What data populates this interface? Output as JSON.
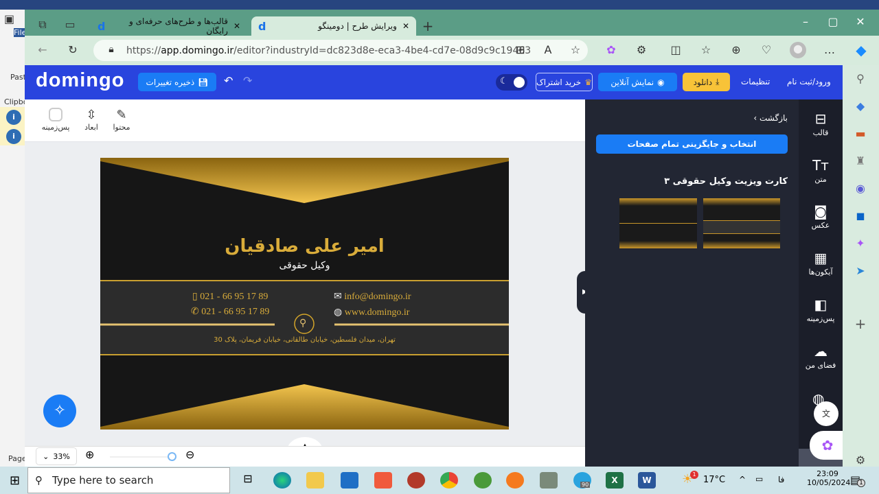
{
  "word": {
    "file": "File",
    "paste": "Paste",
    "clipboard": "Clipbo",
    "page": "Page"
  },
  "browser": {
    "tabs": [
      {
        "title": "قالب‌ها و طرح‌های حرفه‌ای و رایگان",
        "active": false
      },
      {
        "title": "ویرایش طرح | دومینگو",
        "active": true
      }
    ],
    "url_prefix": "https://",
    "url_host": "app.domingo.ir",
    "url_path": "/editor?industryId=dc823d8e-eca3-4be4-cd7e-08d9c9c19463"
  },
  "header": {
    "logo": "domingo",
    "save": "ذخیره تغییرات",
    "subscribe": "خرید اشتراک",
    "preview": "نمایش آنلاین",
    "download": "دانلود",
    "settings": "تنظیمات",
    "login": "ورود/ثبت نام",
    "accent": "#2944de"
  },
  "toolbar": {
    "items": [
      {
        "label": "محتوا",
        "icon": "edit-icon"
      },
      {
        "label": "ابعاد",
        "icon": "resize-icon"
      },
      {
        "label": "پس‌زمینه",
        "icon": "background-swatch-icon"
      }
    ]
  },
  "card": {
    "name": "امیر علی صادقیان",
    "title": "وکیل حقوقی",
    "phone1": "021 - 66 95 17 89",
    "phone2": "021 - 66 95 17 89",
    "email": "info@domingo.ir",
    "web": "www.domingo.ir",
    "address": "تهران، میدان فلسطین، خیابان طالقانی، خیابان فریمان، پلاک 30",
    "gold": "#d4a52a"
  },
  "zoom": {
    "level": "33%",
    "slider_percent": 100
  },
  "panel": {
    "back": "بازگشت",
    "replace_all": "انتخاب و جایگزینی تمام صفحات",
    "template_title": "کارت ویزیت وکیل حقوقی ۳"
  },
  "rail": [
    {
      "label": "قالب",
      "icon": "template-icon"
    },
    {
      "label": "متن",
      "icon": "text-icon"
    },
    {
      "label": "عکس",
      "icon": "image-icon"
    },
    {
      "label": "آیکون‌ها",
      "icon": "icons-grid-icon"
    },
    {
      "label": "پس‌زمینه",
      "icon": "background-icon"
    },
    {
      "label": "فضای من",
      "icon": "cloud-upload-icon"
    }
  ],
  "taskbar": {
    "search": "Type here to search",
    "temp": "17°C",
    "lang": "فا",
    "time": "23:09",
    "date": "10/05/2024",
    "telegram_badge": "90",
    "weather_badge": "1",
    "notif_badge": "1"
  }
}
